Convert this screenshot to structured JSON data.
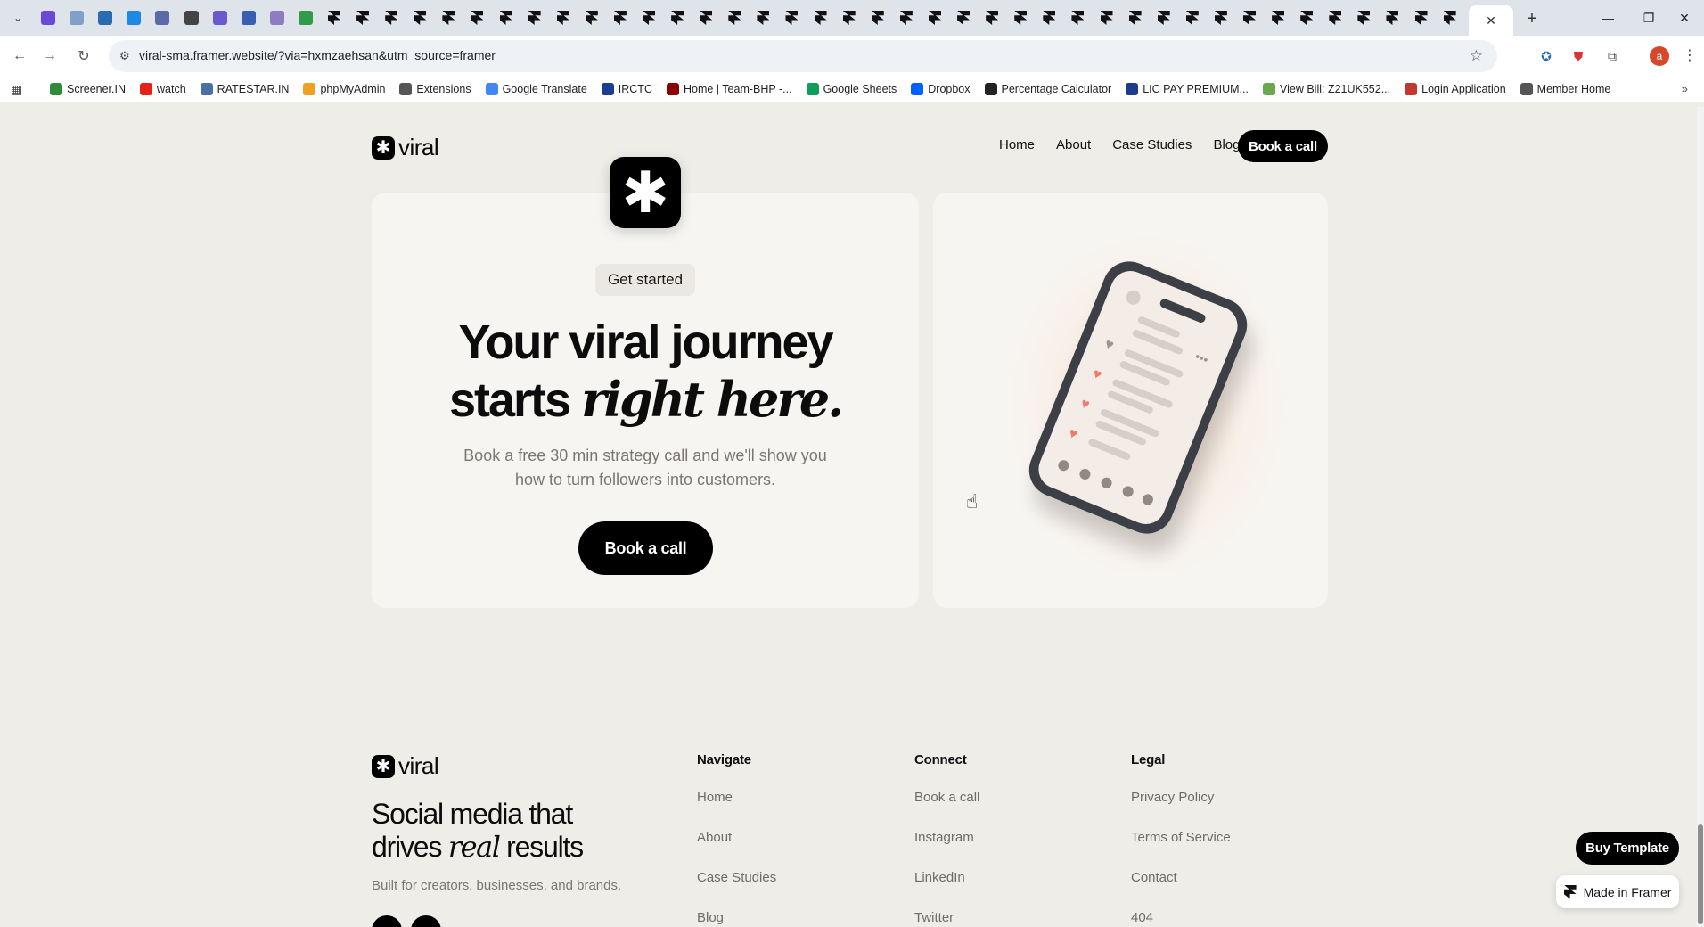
{
  "browser": {
    "url": "viral-sma.framer.website/?via=hxmzaehsan&utm_source=framer",
    "profile_initial": "a",
    "bookmarks": [
      {
        "label": "Screener.IN",
        "color": "#2e8b3a"
      },
      {
        "label": "watch",
        "color": "#e62117"
      },
      {
        "label": "RATESTAR.IN",
        "color": "#4a6fa5"
      },
      {
        "label": "phpMyAdmin",
        "color": "#f0a020"
      },
      {
        "label": "Extensions",
        "color": "#555555"
      },
      {
        "label": "Google Translate",
        "color": "#4285f4"
      },
      {
        "label": "IRCTC",
        "color": "#1a3f8f"
      },
      {
        "label": "Home | Team-BHP -...",
        "color": "#8b0000"
      },
      {
        "label": "Google Sheets",
        "color": "#0f9d58"
      },
      {
        "label": "Dropbox",
        "color": "#0061ff"
      },
      {
        "label": "Percentage Calculator",
        "color": "#222222"
      },
      {
        "label": "LIC PAY PREMIUM...",
        "color": "#1d3b8f"
      },
      {
        "label": "View Bill: Z21UK552...",
        "color": "#6aa84f"
      },
      {
        "label": "Login Application",
        "color": "#c0392b"
      },
      {
        "label": "Member Home",
        "color": "#555555"
      }
    ]
  },
  "site": {
    "logo_text": "viral",
    "logo_mark": "✱",
    "nav": [
      "Home",
      "About",
      "Case Studies",
      "Blog"
    ],
    "nav_cta": "Book a call",
    "cta": {
      "badge": "Get started",
      "heading_line1": "Your viral journey",
      "heading_line2_plain": "starts",
      "heading_line2_italic": "right here.",
      "subtitle": "Book a free 30 min strategy call and we'll show you how to turn followers into customers.",
      "button": "Book a call"
    },
    "footer": {
      "tagline_line1": "Social media that",
      "tagline_line2_plain": "drives",
      "tagline_line2_italic": "real",
      "tagline_line2_end": "results",
      "sub": "Built for creators, businesses, and brands.",
      "columns": [
        {
          "title": "Navigate",
          "links": [
            "Home",
            "About",
            "Case Studies",
            "Blog"
          ]
        },
        {
          "title": "Connect",
          "links": [
            "Book a call",
            "Instagram",
            "LinkedIn",
            "Twitter"
          ]
        },
        {
          "title": "Legal",
          "links": [
            "Privacy Policy",
            "Terms of Service",
            "Contact",
            "404"
          ]
        }
      ]
    },
    "buy_template": "Buy Template",
    "made_in_framer": "Made in Framer"
  }
}
